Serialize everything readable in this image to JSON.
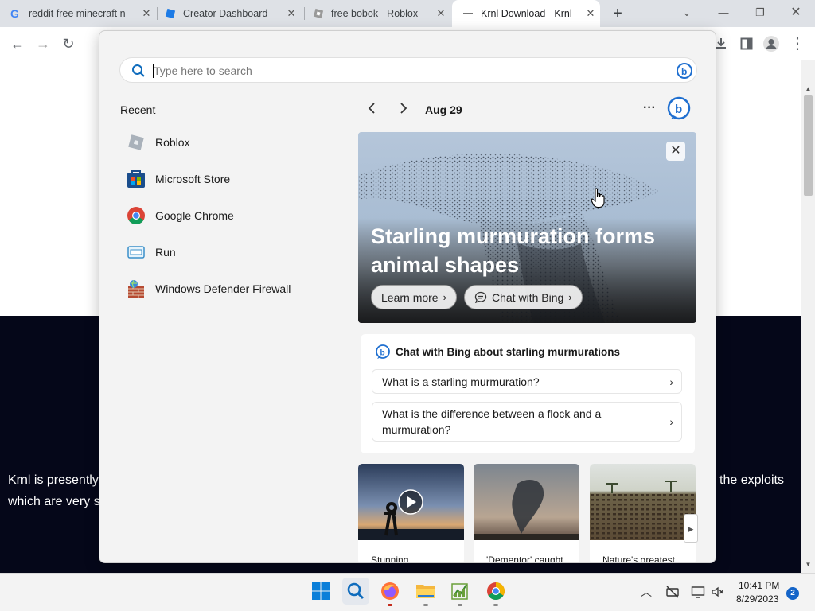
{
  "browser": {
    "tabs": [
      {
        "label": "reddit free minecraft n",
        "icon": "google-icon"
      },
      {
        "label": "Creator Dashboard",
        "icon": "roblox-studio-icon"
      },
      {
        "label": "free bobok - Roblox",
        "icon": "roblox-icon"
      },
      {
        "label": "Krnl Download - Krnl",
        "icon": "loading-icon",
        "active": true
      }
    ],
    "new_tab_glyph": "+"
  },
  "page": {
    "left_text_line1": "Krnl is presently",
    "left_text_line2": "which are very s",
    "right_text_line1": "the exploits"
  },
  "search": {
    "placeholder": "Type here to search",
    "value": ""
  },
  "recent": {
    "title": "Recent",
    "items": [
      {
        "label": "Roblox",
        "icon": "roblox-icon"
      },
      {
        "label": "Microsoft Store",
        "icon": "microsoft-store-icon"
      },
      {
        "label": "Google Chrome",
        "icon": "chrome-icon"
      },
      {
        "label": "Run",
        "icon": "run-icon"
      },
      {
        "label": "Windows Defender Firewall",
        "icon": "firewall-icon"
      }
    ]
  },
  "highlights": {
    "date": "Aug 29",
    "more": "···",
    "hero": {
      "title": "Starling murmuration forms animal shapes",
      "learn_more": "Learn more",
      "chat_with_bing": "Chat with Bing"
    },
    "chat": {
      "heading": "Chat with Bing about starling murmurations",
      "questions": [
        "What is a starling murmuration?",
        "What is the difference between a flock and a murmuration?"
      ]
    },
    "thumbnails": [
      {
        "caption": "Stunning"
      },
      {
        "caption": "'Dementor' caught"
      },
      {
        "caption": "Nature's greatest"
      }
    ]
  },
  "taskbar": {
    "time": "10:41 PM",
    "date": "8/29/2023",
    "notifications": "2"
  }
}
